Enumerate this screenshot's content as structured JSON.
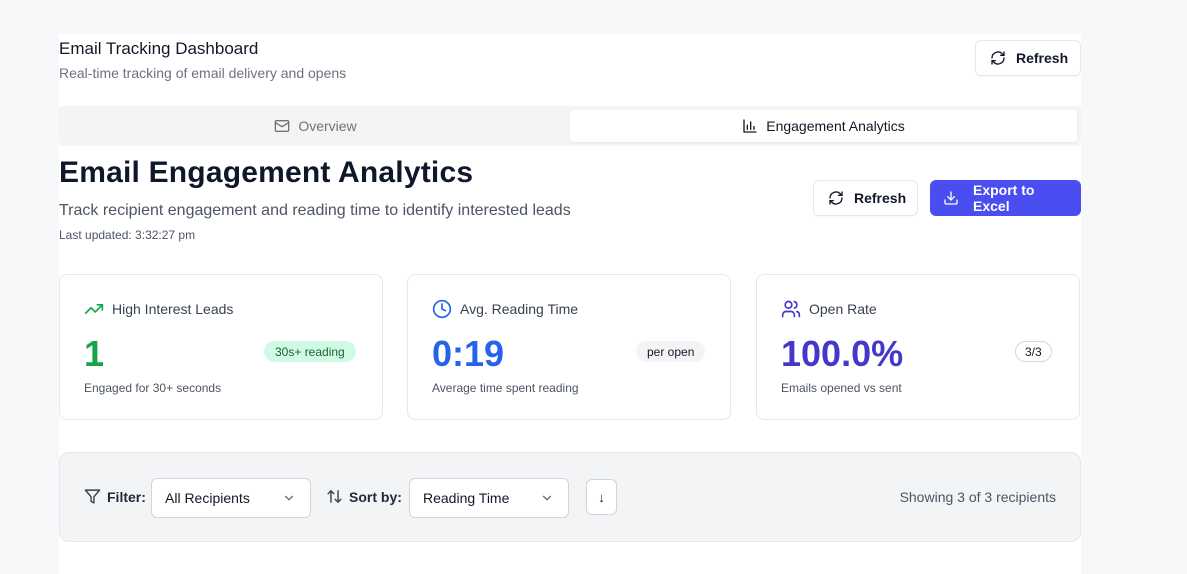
{
  "header": {
    "title": "Email Tracking Dashboard",
    "subtitle": "Real-time tracking of email delivery and opens",
    "refresh_label": "Refresh"
  },
  "tabs": [
    {
      "label": "Overview",
      "icon": "mail-icon",
      "active": false
    },
    {
      "label": "Engagement Analytics",
      "icon": "bar-chart-icon",
      "active": true
    }
  ],
  "analytics": {
    "title": "Email Engagement Analytics",
    "description": "Track recipient engagement and reading time to identify interested leads",
    "last_updated": "Last updated: 3:32:27 pm",
    "refresh_label": "Refresh",
    "export_label": "Export to Excel"
  },
  "stats": [
    {
      "title": "High Interest Leads",
      "icon": "trending-up-icon",
      "value": "1",
      "badge": "30s+ reading",
      "footnote": "Engaged for 30+ seconds",
      "color": "#16a34a"
    },
    {
      "title": "Avg. Reading Time",
      "icon": "clock-icon",
      "value": "0:19",
      "badge": "per open",
      "footnote": "Average time spent reading",
      "color": "#2563eb"
    },
    {
      "title": "Open Rate",
      "icon": "users-icon",
      "value": "100.0%",
      "badge": "3/3",
      "footnote": "Emails opened vs sent",
      "color": "#4338ca"
    }
  ],
  "filters": {
    "filter_label": "Filter:",
    "filter_value": "All Recipients",
    "sort_label": "Sort by:",
    "sort_value": "Reading Time",
    "sort_direction": "↓",
    "showing": "Showing 3 of 3 recipients"
  },
  "colors": {
    "accent": "#4a4ef0",
    "green": "#16a34a",
    "blue": "#2563eb",
    "indigo": "#4338ca"
  }
}
